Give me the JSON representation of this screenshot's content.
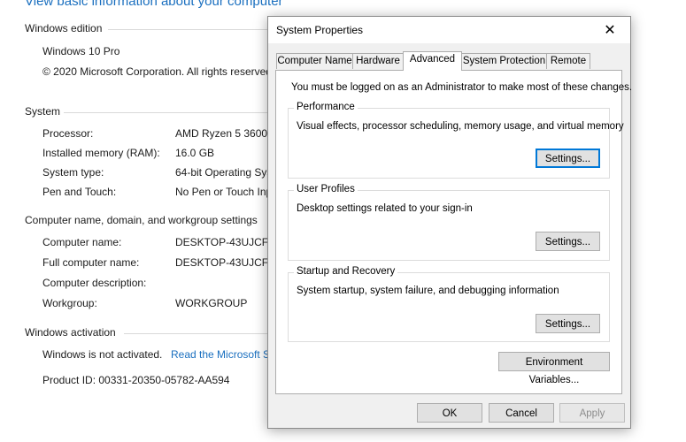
{
  "background": {
    "heading": "View basic information about your computer",
    "windows_edition": {
      "section": "Windows edition",
      "edition": "Windows 10 Pro",
      "copyright": "© 2020 Microsoft Corporation. All rights reserved."
    },
    "system": {
      "section": "System",
      "rows": [
        {
          "label": "Processor:",
          "value": "AMD Ryzen 5 3600 6"
        },
        {
          "label": "Installed memory (RAM):",
          "value": "16.0 GB"
        },
        {
          "label": "System type:",
          "value": "64-bit Operating Sys"
        },
        {
          "label": "Pen and Touch:",
          "value": "No Pen or Touch Inp"
        }
      ]
    },
    "computer_name": {
      "section": "Computer name, domain, and workgroup settings",
      "rows": [
        {
          "label": "Computer name:",
          "value": "DESKTOP-43UJCFF"
        },
        {
          "label": "Full computer name:",
          "value": "DESKTOP-43UJCFF"
        },
        {
          "label": "Computer description:",
          "value": ""
        },
        {
          "label": "Workgroup:",
          "value": "WORKGROUP"
        }
      ]
    },
    "activation": {
      "section": "Windows activation",
      "status": "Windows is not activated.",
      "link": "Read the Microsoft S",
      "product_id": "Product ID:  00331-20350-05782-AA594"
    }
  },
  "dialog": {
    "title": "System Properties",
    "close_glyph": "✕",
    "tabs": [
      {
        "label": "Computer Name",
        "active": false
      },
      {
        "label": "Hardware",
        "active": false
      },
      {
        "label": "Advanced",
        "active": true
      },
      {
        "label": "System Protection",
        "active": false
      },
      {
        "label": "Remote",
        "active": false
      }
    ],
    "admin_note": "You must be logged on as an Administrator to make most of these changes.",
    "groups": {
      "performance": {
        "label": "Performance",
        "description": "Visual effects, processor scheduling, memory usage, and virtual memory",
        "button": "Settings..."
      },
      "user_profiles": {
        "label": "User Profiles",
        "description": "Desktop settings related to your sign-in",
        "button": "Settings..."
      },
      "startup_recovery": {
        "label": "Startup and Recovery",
        "description": "System startup, system failure, and debugging information",
        "button": "Settings..."
      }
    },
    "env_button": "Environment Variables...",
    "footer": {
      "ok": "OK",
      "cancel": "Cancel",
      "apply": "Apply"
    }
  },
  "colors": {
    "link": "#1a6fbf",
    "focus": "#0078d7",
    "dialog_bg": "#f0f0f0"
  }
}
